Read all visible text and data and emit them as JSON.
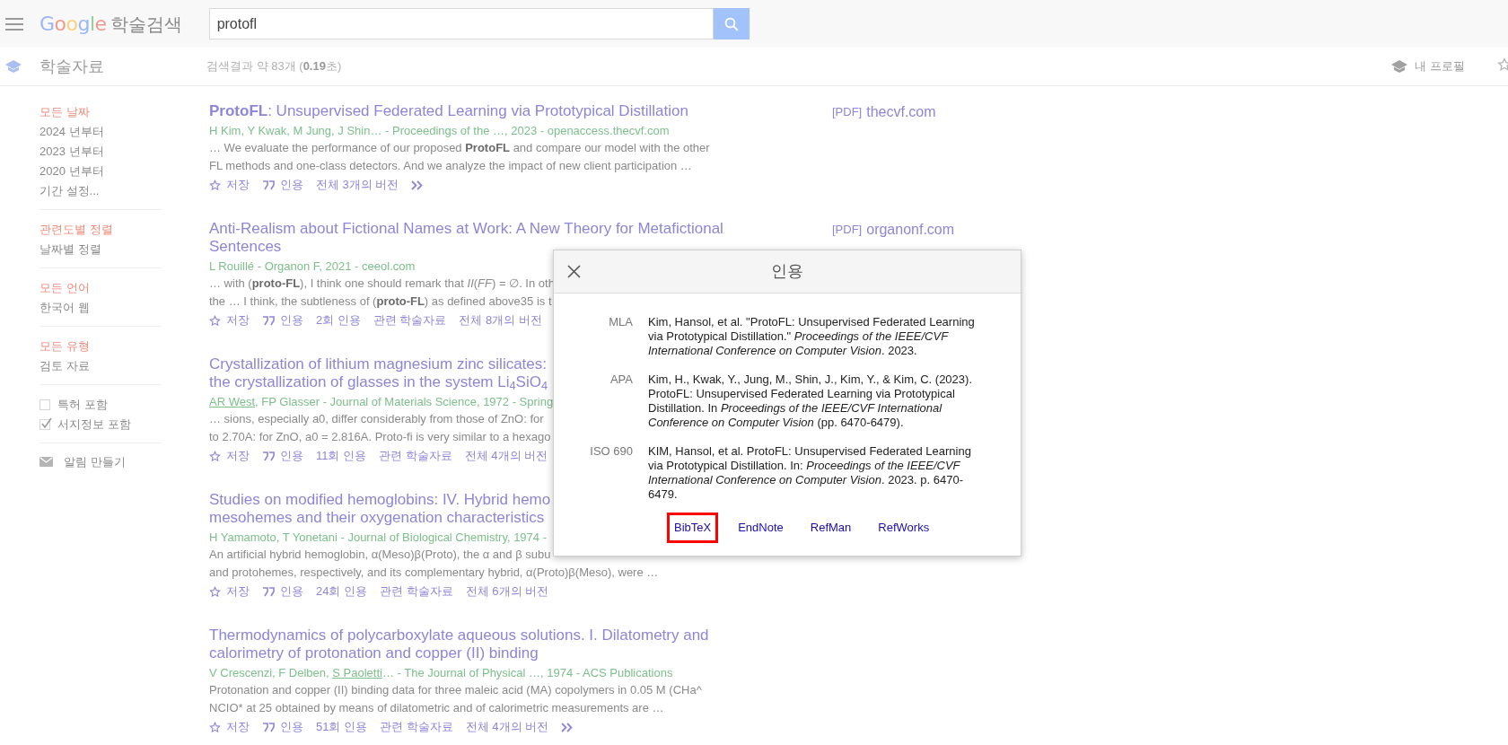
{
  "header": {
    "logo": {
      "brand": "Google",
      "product": "학술검색"
    },
    "search": {
      "value": "protofl"
    }
  },
  "subheader": {
    "section": "학술자료",
    "result_count": "검색결과 약 83개 (**0.19**초)",
    "profile": "내 프로필"
  },
  "sidebar": {
    "groups": [
      {
        "items": [
          {
            "label": "모든 날짜",
            "selected": true
          },
          {
            "label": "2024 년부터",
            "selected": false
          },
          {
            "label": "2023 년부터",
            "selected": false
          },
          {
            "label": "2020 년부터",
            "selected": false
          },
          {
            "label": "기간 설정...",
            "selected": false
          }
        ]
      },
      {
        "items": [
          {
            "label": "관련도별 정렬",
            "selected": true
          },
          {
            "label": "날짜별 정렬",
            "selected": false
          }
        ]
      },
      {
        "items": [
          {
            "label": "모든 언어",
            "selected": true
          },
          {
            "label": "한국어 웹",
            "selected": false
          }
        ]
      },
      {
        "items": [
          {
            "label": "모든 유형",
            "selected": true
          },
          {
            "label": "검토 자료",
            "selected": false
          }
        ]
      }
    ],
    "options": [
      {
        "label": "특허 포함",
        "checked": false
      },
      {
        "label": "서지정보 포함",
        "checked": true
      }
    ],
    "alert": "알림 만들기"
  },
  "results": [
    {
      "title_lines": [
        "**ProtoFL**: Unsupervised Federated Learning via Prototypical Distillation"
      ],
      "authors": [
        {
          "text": "H Kim, Y Kwak, M Jung, J Shin… - Proceedings of the …, 2023 - openaccess.thecvf.com",
          "linked": false
        }
      ],
      "snippet_lines": [
        "… We evaluate the performance of our proposed **ProtoFL** and compare our model with the other",
        "FL methods and one-class detectors. And we analyze the impact of new client participation …"
      ],
      "actions": [
        {
          "kind": "save",
          "label": "저장"
        },
        {
          "kind": "cite",
          "label": "인용"
        },
        {
          "kind": "text",
          "label": "전체 3개의 버전"
        },
        {
          "kind": "more"
        }
      ],
      "side": [
        {
          "tag": "[PDF]",
          "host": "thecvf.com"
        }
      ]
    },
    {
      "title_lines": [
        "Anti-Realism about Fictional Names at Work: A New Theory for Metafictional",
        "Sentences"
      ],
      "authors": [
        {
          "text": "L Rouillé - Organon F, 2021 - ceeol.com",
          "linked": false
        }
      ],
      "snippet_lines": [
        "… with (**proto-FL**), I think one should remark that *II*(*FF*) = ∅. In oth",
        "the … I think, the subtleness of (**proto-FL**) as defined above35 is t"
      ],
      "actions": [
        {
          "kind": "save",
          "label": "저장"
        },
        {
          "kind": "cite",
          "label": "인용"
        },
        {
          "kind": "text",
          "label": "2회 인용"
        },
        {
          "kind": "text",
          "label": "관련 학술자료"
        },
        {
          "kind": "text",
          "label": "전체 8개의 버전"
        }
      ],
      "side": [
        {
          "tag": "[PDF]",
          "host": "organonf.com"
        }
      ]
    },
    {
      "title_lines": [
        "Crystallization of lithium magnesium zinc silicates:",
        "the crystallization of glasses in the system Li$_{4}$SiO$_{4}$"
      ],
      "authors": [
        {
          "text": "AR West",
          "linked": true
        },
        {
          "text": ", FP Glasser - Journal of Materials Science, 1972 - Spring",
          "linked": false
        }
      ],
      "snippet_lines": [
        "… sions, especially a0, differ considerably from those of ZnO: for",
        "to 2.70A: for ZnO, a0 = 2.816A. Proto-fi is very similar to a hexago"
      ],
      "actions": [
        {
          "kind": "save",
          "label": "저장"
        },
        {
          "kind": "cite",
          "label": "인용"
        },
        {
          "kind": "text",
          "label": "11회 인용"
        },
        {
          "kind": "text",
          "label": "관련 학술자료"
        },
        {
          "kind": "text",
          "label": "전체 4개의 버전"
        }
      ]
    },
    {
      "title_lines": [
        "Studies on modified hemoglobins: IV. Hybrid hemo",
        "mesohemes and their oxygenation characteristics"
      ],
      "authors": [
        {
          "text": "H Yamamoto, T Yonetani - Journal of Biological Chemistry, 1974 -",
          "linked": false
        }
      ],
      "snippet_lines": [
        "An artificial hybrid hemoglobin, α(Meso)β(Proto), the α and β subu",
        "and protohemes, respectively, and its complementary hybrid, α(Proto)β(Meso), were …"
      ],
      "actions": [
        {
          "kind": "save",
          "label": "저장"
        },
        {
          "kind": "cite",
          "label": "인용"
        },
        {
          "kind": "text",
          "label": "24회 인용"
        },
        {
          "kind": "text",
          "label": "관련 학술자료"
        },
        {
          "kind": "text",
          "label": "전체 6개의 버전"
        }
      ]
    },
    {
      "title_lines": [
        "Thermodynamics of polycarboxylate aqueous solutions. I. Dilatometry and",
        "calorimetry of protonation and copper (II) binding"
      ],
      "authors": [
        {
          "text": "V Crescenzi, F Delben, ",
          "linked": false
        },
        {
          "text": "S Paoletti",
          "linked": true
        },
        {
          "text": "… - The Journal of Physical …, 1974 - ACS Publications",
          "linked": false
        }
      ],
      "snippet_lines": [
        "Protonation and copper (II) binding data for three maleic acid (MA) copolymers in 0.05 M (CHa^",
        "NCIO* at 25 obtained by means of dilatometric and of calorimetric measurements are …"
      ],
      "actions": [
        {
          "kind": "save",
          "label": "저장"
        },
        {
          "kind": "cite",
          "label": "인용"
        },
        {
          "kind": "text",
          "label": "51회 인용"
        },
        {
          "kind": "text",
          "label": "관련 학술자료"
        },
        {
          "kind": "text",
          "label": "전체 4개의 버전"
        },
        {
          "kind": "more"
        }
      ]
    }
  ],
  "cite_dialog": {
    "title": "인용",
    "citations": [
      {
        "style": "MLA",
        "text": "Kim, Hansol, et al. \"ProtoFL: Unsupervised Federated Learning via Prototypical Distillation.\" *Proceedings of the IEEE/CVF International Conference on Computer Vision*. 2023."
      },
      {
        "style": "APA",
        "text": "Kim, H., Kwak, Y., Jung, M., Shin, J., Kim, Y., & Kim, C. (2023). ProtoFL: Unsupervised Federated Learning via Prototypical Distillation. In *Proceedings of the IEEE/CVF International Conference on Computer Vision* (pp. 6470-6479)."
      },
      {
        "style": "ISO 690",
        "text": "KIM, Hansol, et al. ProtoFL: Unsupervised Federated Learning via Prototypical Distillation. In: *Proceedings of the IEEE/CVF International Conference on Computer Vision*. 2023. p. 6470-6479."
      }
    ],
    "exports": [
      {
        "label": "BibTeX",
        "highlighted": true
      },
      {
        "label": "EndNote",
        "highlighted": false
      },
      {
        "label": "RefMan",
        "highlighted": false
      },
      {
        "label": "RefWorks",
        "highlighted": false
      }
    ]
  }
}
